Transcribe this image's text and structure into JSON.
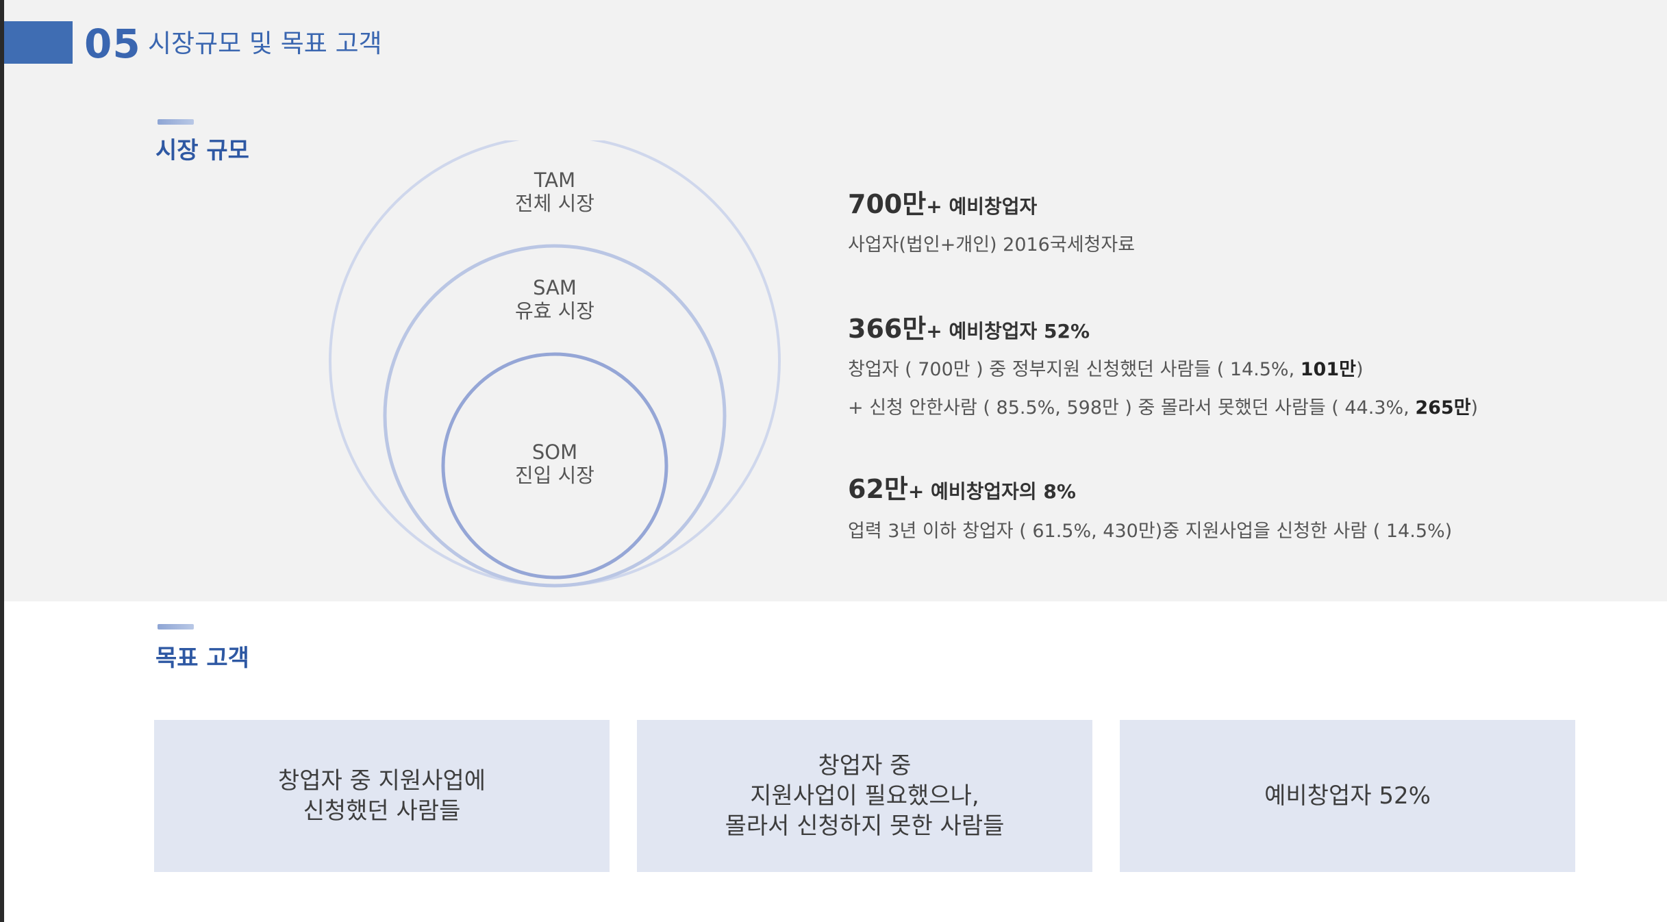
{
  "header": {
    "number": "05",
    "title": "시장규모 및 목표 고객",
    "accent_color": "#3f6db3"
  },
  "market_size": {
    "section_title": "시장 규모",
    "circles": {
      "tam": {
        "name": "TAM",
        "desc": "전체 시장"
      },
      "sam": {
        "name": "SAM",
        "desc": "유효 시장"
      },
      "som": {
        "name": "SOM",
        "desc": "진입 시장"
      }
    },
    "stats": [
      {
        "value": "700만",
        "suffix": "+ 예비창업자",
        "lines": [
          {
            "text": "사업자(법인+개인) 2016국세청자료",
            "bold": ""
          }
        ]
      },
      {
        "value": "366만",
        "suffix": "+ 예비창업자 52%",
        "lines": [
          {
            "text": "창업자 ( 700만 ) 중 정부지원 신청했던 사람들 ( 14.5%, ",
            "bold": "101만",
            "tail": ")"
          },
          {
            "text": "+ 신청 안한사람 ( 85.5%, 598만 ) 중 몰라서 못했던 사람들 ( 44.3%, ",
            "bold": "265만",
            "tail": ")"
          }
        ]
      },
      {
        "value": "62만",
        "suffix": "+ 예비창업자의 8%",
        "lines": [
          {
            "text": "업력 3년 이하 창업자 ( 61.5%, 430만)중 지원사업을 신청한 사람 ( 14.5%)",
            "bold": ""
          }
        ]
      }
    ]
  },
  "target_customers": {
    "section_title": "목표 고객",
    "boxes": [
      {
        "lines": [
          "창업자 중 지원사업에",
          "신청했던 사람들"
        ]
      },
      {
        "lines": [
          "창업자 중",
          "지원사업이 필요했으나,",
          "몰라서 신청하지 못한 사람들"
        ]
      },
      {
        "lines": [
          "예비창업자 52%"
        ]
      }
    ]
  }
}
